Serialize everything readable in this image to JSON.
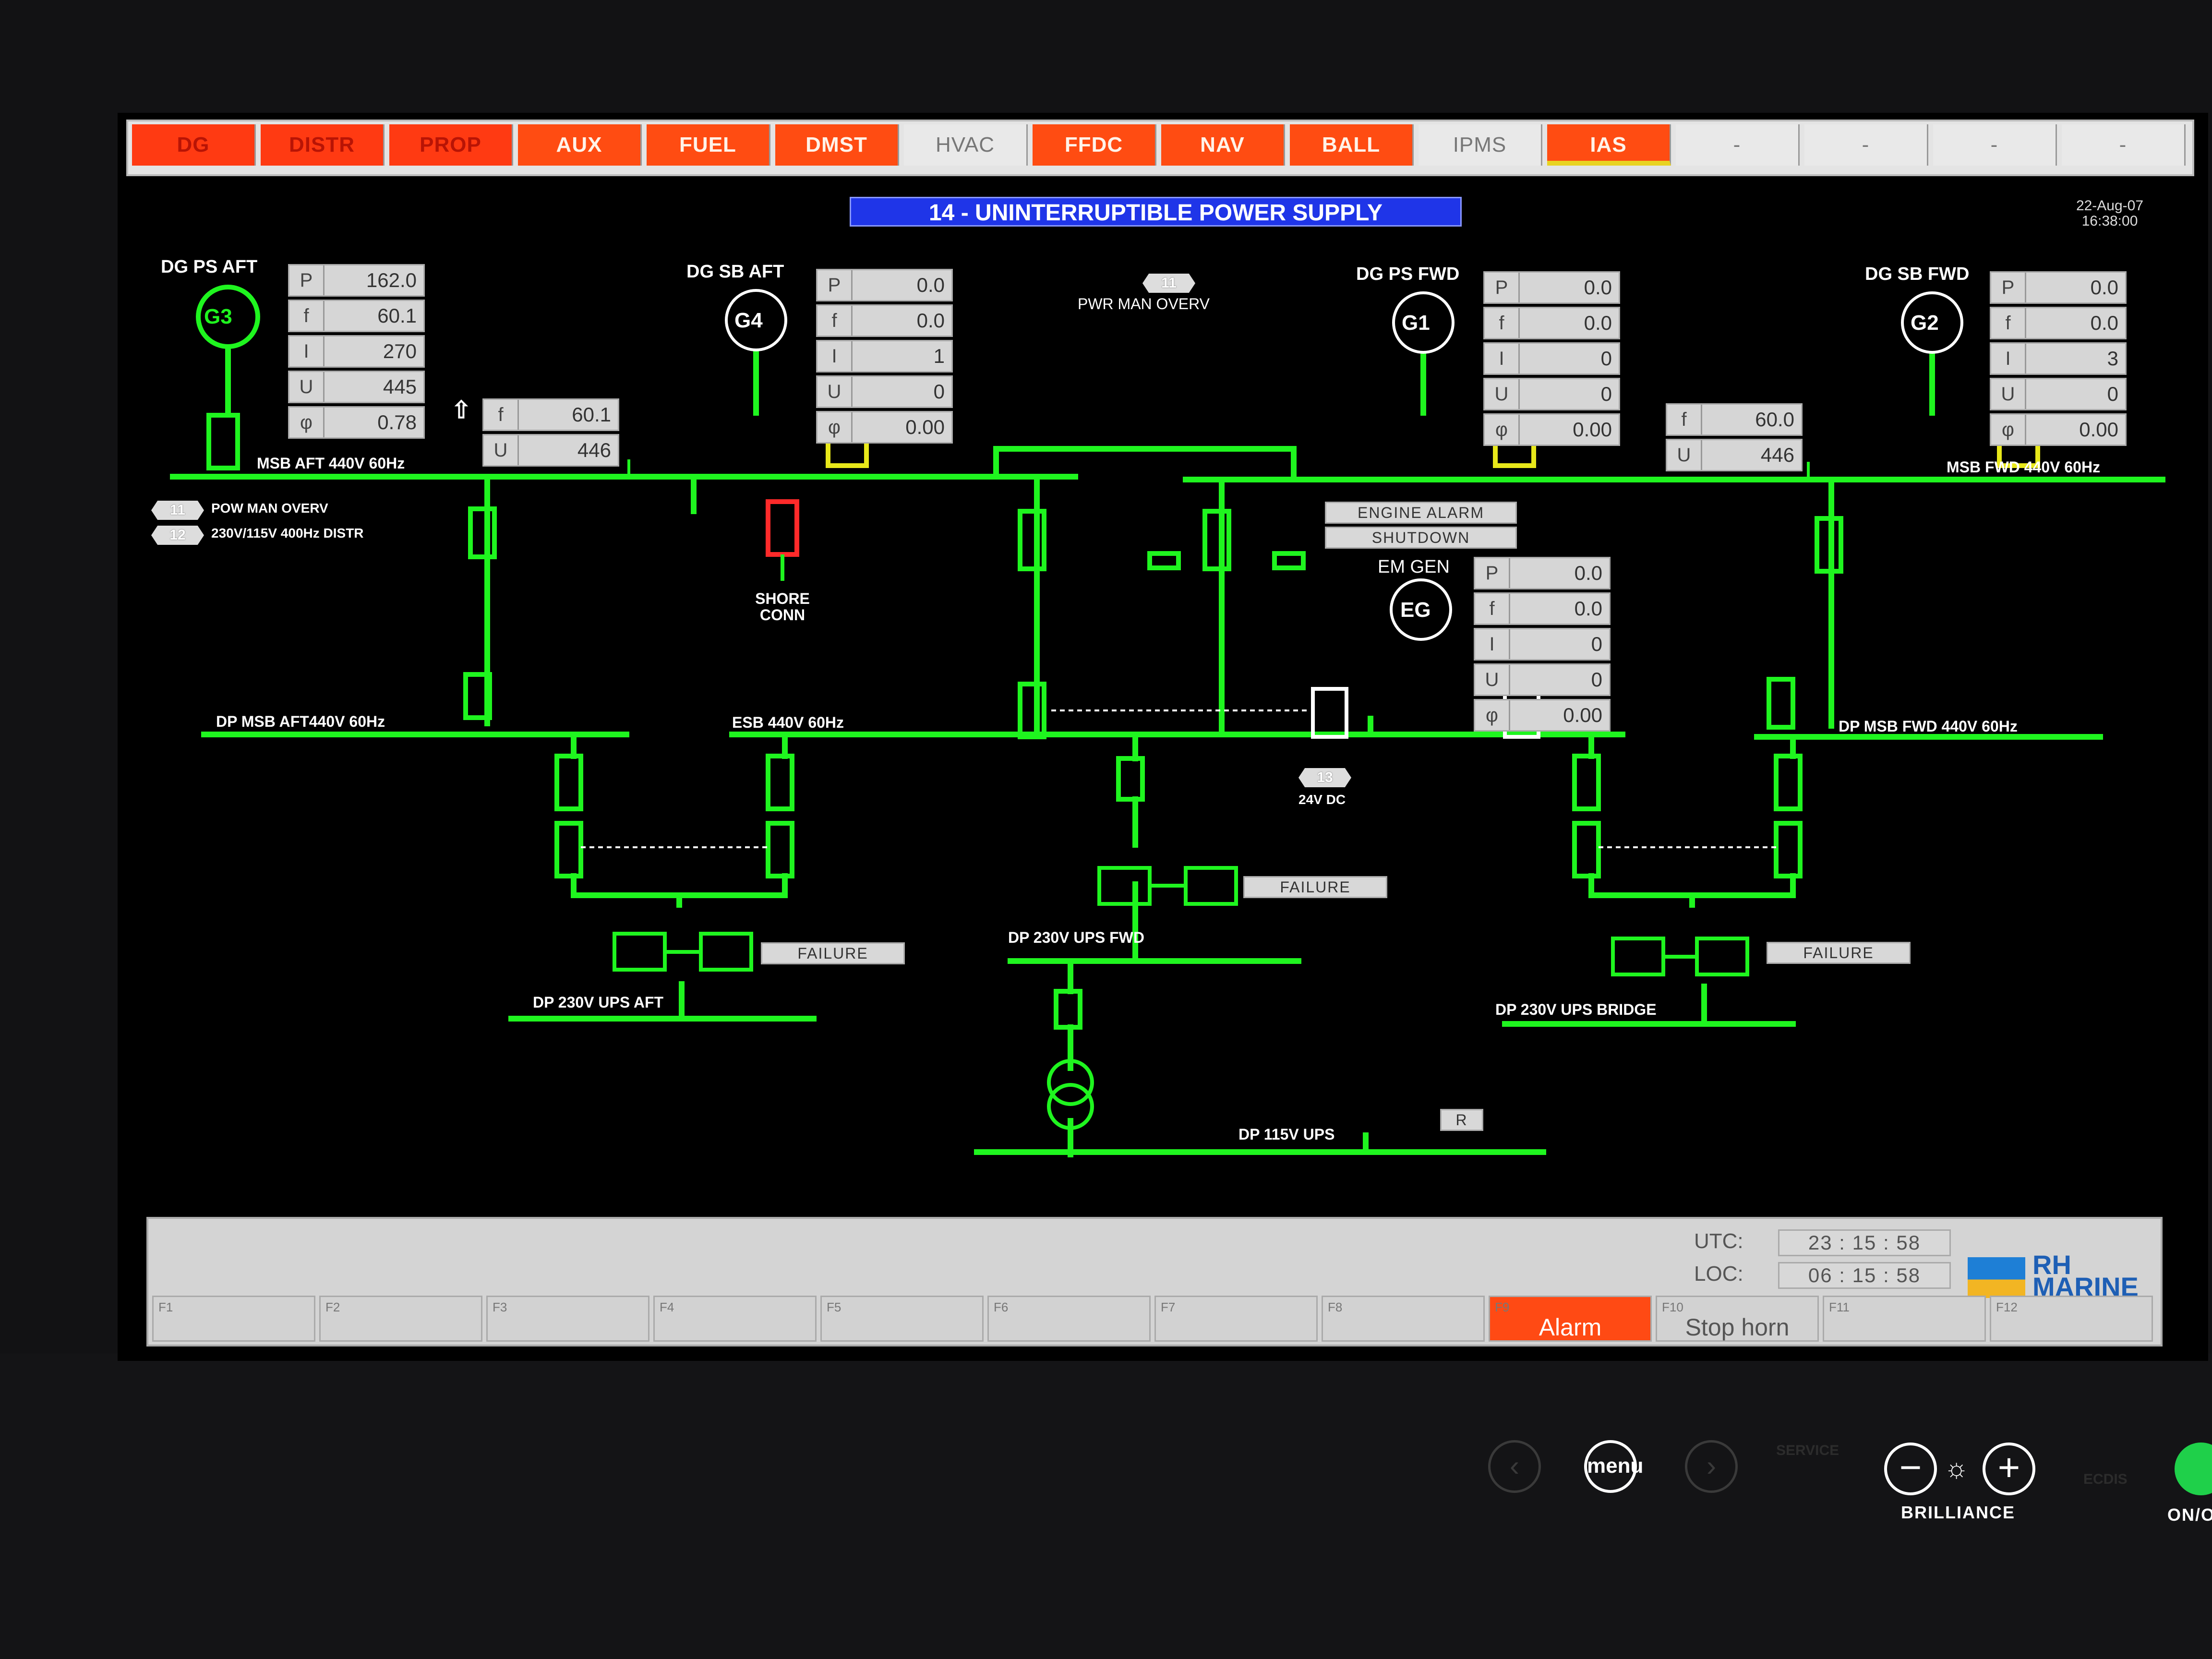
{
  "tabs": [
    {
      "label": "DG",
      "style": "red"
    },
    {
      "label": "DISTR",
      "style": "red"
    },
    {
      "label": "PROP",
      "style": "red"
    },
    {
      "label": "AUX",
      "style": "orange"
    },
    {
      "label": "FUEL",
      "style": "orange"
    },
    {
      "label": "DMST",
      "style": "orange"
    },
    {
      "label": "HVAC",
      "style": "grey"
    },
    {
      "label": "FFDC",
      "style": "orange"
    },
    {
      "label": "NAV",
      "style": "orange"
    },
    {
      "label": "BALL",
      "style": "orange"
    },
    {
      "label": "IPMS",
      "style": "grey"
    },
    {
      "label": "IAS",
      "style": "orange"
    },
    {
      "label": "-",
      "style": "grey"
    },
    {
      "label": "-",
      "style": "grey"
    },
    {
      "label": "-",
      "style": "grey"
    },
    {
      "label": "-",
      "style": "grey"
    }
  ],
  "page": {
    "title": "14 - UNINTERRUPTIBLE POWER SUPPLY",
    "date": "22-Aug-07",
    "time": "16:38:00"
  },
  "generators": {
    "g3": {
      "name": "DG PS AFT",
      "symbol": "G3",
      "P": "162.0",
      "f": "60.1",
      "I": "270",
      "U": "445",
      "phi": "0.78"
    },
    "g4": {
      "name": "DG SB AFT",
      "symbol": "G4",
      "P": "0.0",
      "f": "0.0",
      "I": "1",
      "U": "0",
      "phi": "0.00"
    },
    "g1": {
      "name": "DG PS FWD",
      "symbol": "G1",
      "P": "0.0",
      "f": "0.0",
      "I": "0",
      "U": "0",
      "phi": "0.00"
    },
    "g2": {
      "name": "DG SB FWD",
      "symbol": "G2",
      "P": "0.0",
      "f": "0.0",
      "I": "3",
      "U": "0",
      "phi": "0.00"
    },
    "eg": {
      "name": "EM GEN",
      "symbol": "EG",
      "P": "0.0",
      "f": "0.0",
      "I": "0",
      "U": "0",
      "phi": "0.00"
    }
  },
  "meter_keys": {
    "P": "P",
    "f": "f",
    "I": "I",
    "U": "U",
    "phi": "φ"
  },
  "bus_aft_meter": {
    "f": "60.1",
    "U": "446"
  },
  "bus_fwd_meter": {
    "f": "60.0",
    "U": "446"
  },
  "buses": {
    "msb_aft": "MSB AFT 440V 60Hz",
    "msb_fwd": "MSB FWD 440V 60Hz",
    "dp_msb_aft": "DP MSB AFT440V 60Hz",
    "esb": "ESB 440V 60Hz",
    "dp_msb_fwd": "DP MSB FWD 440V 60Hz",
    "ups_aft": "DP 230V UPS AFT",
    "ups_fwd": "DP 230V UPS FWD",
    "ups_bridge": "DP 230V UPS BRIDGE",
    "dp115": "DP 115V UPS"
  },
  "links": {
    "t11_top": {
      "num": "11",
      "label": "PWR MAN OVERV"
    },
    "t11_left": {
      "num": "11",
      "label": "POW MAN OVERV"
    },
    "t12_left": {
      "num": "12",
      "label": "230V/115V 400Hz DISTR"
    },
    "t13": {
      "num": "13",
      "label": "24V DC"
    }
  },
  "shore": {
    "line1": "SHORE",
    "line2": "CONN"
  },
  "buttons": {
    "engine_alarm": "ENGINE ALARM",
    "shutdown": "SHUTDOWN",
    "failure": "FAILURE",
    "r": "R"
  },
  "fkeys": [
    {
      "key": "F1",
      "label": ""
    },
    {
      "key": "F2",
      "label": ""
    },
    {
      "key": "F3",
      "label": ""
    },
    {
      "key": "F4",
      "label": ""
    },
    {
      "key": "F5",
      "label": ""
    },
    {
      "key": "F6",
      "label": ""
    },
    {
      "key": "F7",
      "label": ""
    },
    {
      "key": "F8",
      "label": ""
    },
    {
      "key": "F9",
      "label": "Alarm"
    },
    {
      "key": "F10",
      "label": "Stop horn"
    },
    {
      "key": "F11",
      "label": ""
    },
    {
      "key": "F12",
      "label": ""
    }
  ],
  "clocks": {
    "utc_label": "UTC:",
    "utc": "23 : 15 : 58",
    "loc_label": "LOC:",
    "loc": "06 : 15 : 58"
  },
  "logo": {
    "line1": "RH",
    "line2": "MARINE"
  },
  "hardware": {
    "menu": "menu",
    "brilliance": "BRILLIANCE",
    "onoff": "ON/O",
    "service": "SERVICE",
    "ecdis": "ECDIS"
  },
  "colors": {
    "bus": "#1ff51f",
    "breaker_yellow": "#e8e81a",
    "breaker_red": "#ff2a2a",
    "alarm": "#ff4a14",
    "title": "#1f35e8"
  }
}
